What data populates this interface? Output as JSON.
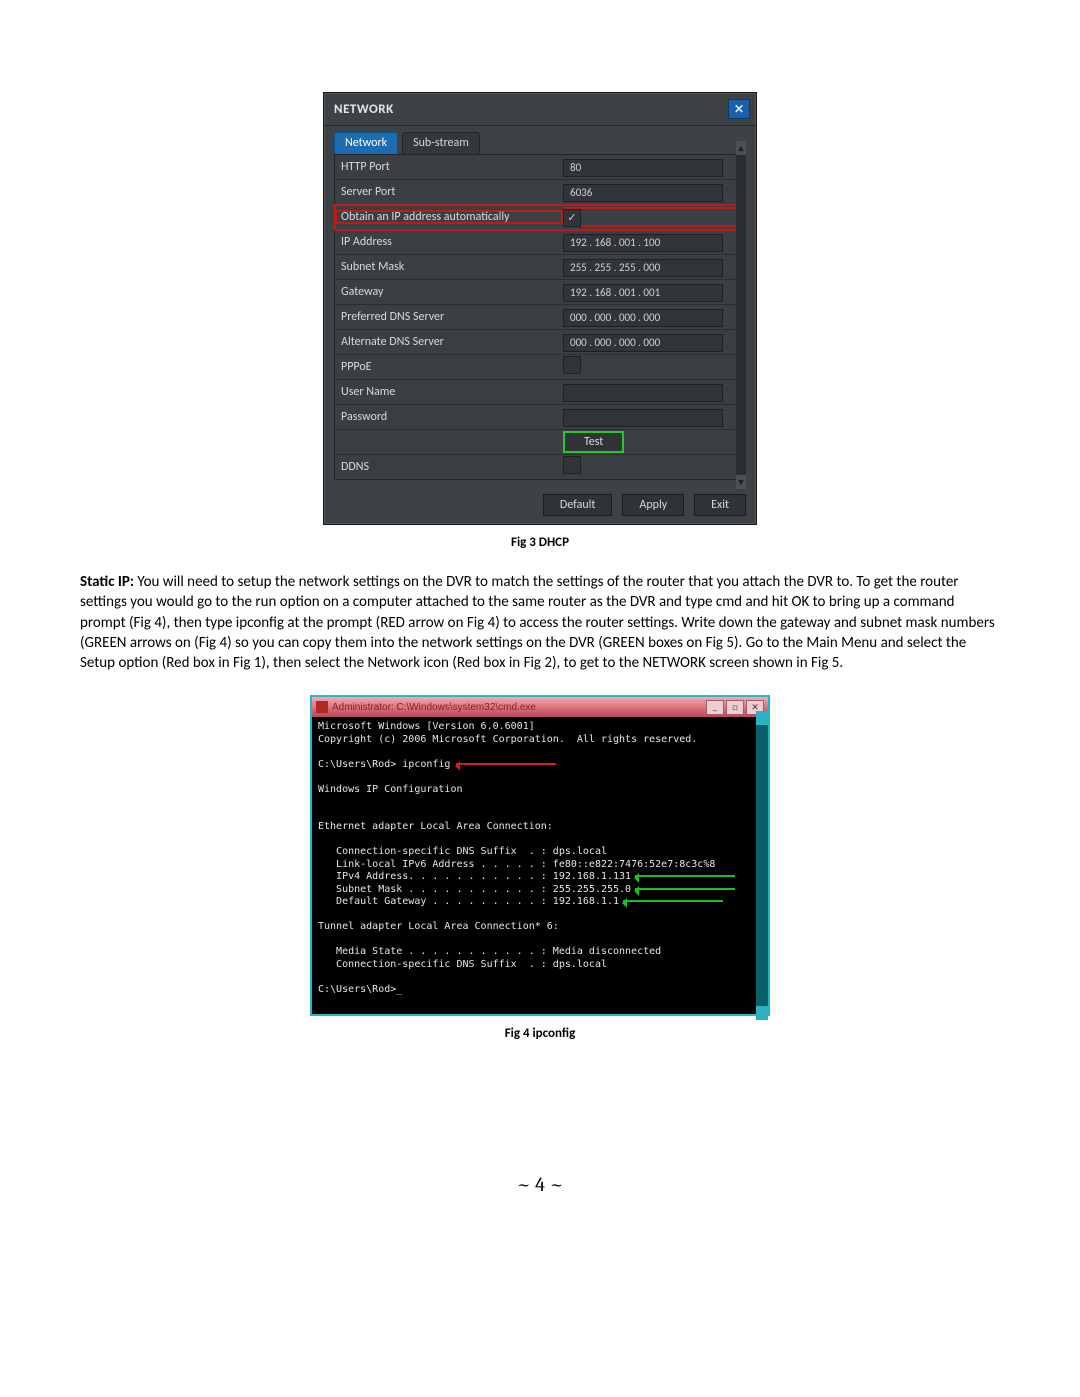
{
  "fig3": {
    "window_title": "NETWORK",
    "tabs": {
      "network": "Network",
      "substream": "Sub-stream"
    },
    "rows": {
      "http_port": {
        "label": "HTTP Port",
        "value": "80"
      },
      "server_port": {
        "label": "Server Port",
        "value": "6036"
      },
      "auto_ip": {
        "label": "Obtain an IP address automatically",
        "checked": "✓"
      },
      "ip_address": {
        "label": "IP Address",
        "value": "192 . 168 . 001 . 100"
      },
      "subnet": {
        "label": "Subnet Mask",
        "value": "255 . 255 . 255 . 000"
      },
      "gateway": {
        "label": "Gateway",
        "value": "192 . 168 . 001 . 001"
      },
      "pref_dns": {
        "label": "Preferred DNS Server",
        "value": "000 . 000 . 000 . 000"
      },
      "alt_dns": {
        "label": "Alternate DNS Server",
        "value": "000 . 000 . 000 . 000"
      },
      "pppoe": {
        "label": "PPPoE"
      },
      "user": {
        "label": "User Name",
        "value": ""
      },
      "password": {
        "label": "Password",
        "value": ""
      },
      "test": {
        "label": "",
        "btn": "Test"
      },
      "ddns": {
        "label": "DDNS"
      }
    },
    "buttons": {
      "default": "Default",
      "apply": "Apply",
      "exit": "Exit"
    },
    "caption": "Fig 3 DHCP"
  },
  "paragraph": {
    "heading": "Static IP: ",
    "text": "You will need to setup the network settings on the DVR to match the settings of the router that you attach the DVR to. To get the router settings you would go to the run option on a computer attached to the same router as the DVR and type cmd and hit OK to bring up a command prompt (Fig 4), then type ipconfig at the prompt (RED arrow on Fig 4) to access the router settings. Write down the gateway and subnet mask numbers (GREEN arrows on (Fig 4) so you can copy them into the network settings on the DVR (GREEN boxes on Fig 5). Go to the Main Menu and select the Setup option (Red box in Fig 1), then select the Network icon (Red box in Fig 2), to get to the NETWORK screen shown in Fig 5."
  },
  "fig4": {
    "title": "Administrator: C:\\Windows\\system32\\cmd.exe",
    "lines": {
      "l1": "Microsoft Windows [Version 6.0.6001]",
      "l2": "Copyright (c) 2006 Microsoft Corporation.  All rights reserved.",
      "l3": "",
      "l4a": "C:\\Users\\Rod> ipconfig",
      "l5": "",
      "l6": "Windows IP Configuration",
      "l7": "",
      "l8": "",
      "l9": "Ethernet adapter Local Area Connection:",
      "l10": "",
      "l11": "   Connection-specific DNS Suffix  . : dps.local",
      "l12": "   Link-local IPv6 Address . . . . . : fe80::e822:7476:52e7:8c3c%8",
      "l13a": "   IPv4 Address. . . . . . . . . . . : 192.168.1.131",
      "l14a": "   Subnet Mask . . . . . . . . . . . : 255.255.255.0",
      "l15a": "   Default Gateway . . . . . . . . . : 192.168.1.1",
      "l16": "",
      "l17": "Tunnel adapter Local Area Connection* 6:",
      "l18": "",
      "l19": "   Media State . . . . . . . . . . . : Media disconnected",
      "l20": "   Connection-specific DNS Suffix  . : dps.local",
      "l21": "",
      "l22": "C:\\Users\\Rod>_"
    },
    "caption": "Fig 4 ipconfig"
  },
  "page_number": "~ 4 ~"
}
